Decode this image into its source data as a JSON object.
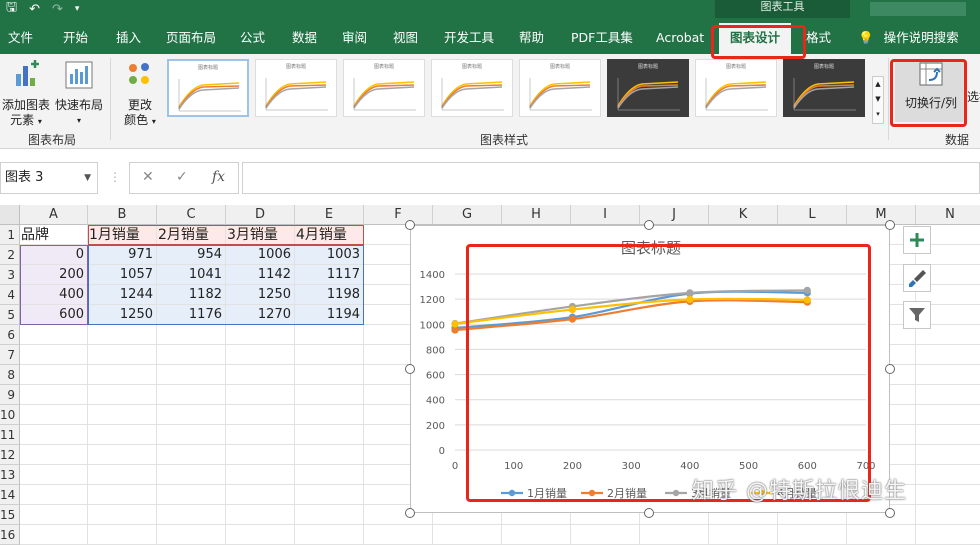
{
  "titlebar": {
    "context_label": "图表工具"
  },
  "tabs": [
    {
      "label": "文件"
    },
    {
      "label": "开始"
    },
    {
      "label": "插入"
    },
    {
      "label": "页面布局"
    },
    {
      "label": "公式"
    },
    {
      "label": "数据"
    },
    {
      "label": "审阅"
    },
    {
      "label": "视图"
    },
    {
      "label": "开发工具"
    },
    {
      "label": "帮助"
    },
    {
      "label": "PDF工具集"
    },
    {
      "label": "Acrobat"
    },
    {
      "label": "图表设计"
    },
    {
      "label": "格式"
    },
    {
      "label": "操作说明搜索"
    }
  ],
  "ribbon": {
    "add_element": "添加图表元素",
    "add_element_l1": "添加图表",
    "add_element_l2": "元素",
    "quick_layout": "快速布局",
    "group_layout": "图表布局",
    "change_colors_l1": "更改",
    "change_colors_l2": "颜色",
    "group_styles": "图表样式",
    "style_thumb_title": "图表标题",
    "switch_row_col": "切换行/列",
    "select_data": "选择",
    "group_data": "数据"
  },
  "formula_bar": {
    "name_box": "图表 3",
    "fx": "fx",
    "cancel": "✕",
    "enter": "✓",
    "formula": ""
  },
  "sheet": {
    "columns": [
      "A",
      "B",
      "C",
      "D",
      "E",
      "F",
      "G",
      "H",
      "I",
      "J",
      "K",
      "L",
      "M",
      "N"
    ],
    "rows": [
      "1",
      "2",
      "3",
      "4",
      "5",
      "6",
      "7",
      "8",
      "9",
      "10",
      "11",
      "12",
      "13",
      "14",
      "15",
      "16"
    ],
    "header_cells": [
      "品牌",
      "1月销量",
      "2月销量",
      "3月销量",
      "4月销量"
    ],
    "data_rows": [
      [
        "0",
        "971",
        "954",
        "1006",
        "1003"
      ],
      [
        "200",
        "1057",
        "1041",
        "1142",
        "1117"
      ],
      [
        "400",
        "1244",
        "1182",
        "1250",
        "1198"
      ],
      [
        "600",
        "1250",
        "1176",
        "1270",
        "1194"
      ]
    ]
  },
  "colors": {
    "excel_green": "#217346",
    "highlight": "#e8261c",
    "s1": "#5b9bd5",
    "s2": "#ed7d31",
    "s3": "#a5a5a5",
    "s4": "#ffc000"
  },
  "chart_data": {
    "type": "scatter",
    "title": "图表标题",
    "smooth": true,
    "x": [
      0,
      200,
      400,
      600
    ],
    "xlim": [
      0,
      700
    ],
    "ylim": [
      0,
      1400
    ],
    "xticks": [
      0,
      100,
      200,
      300,
      400,
      500,
      600,
      700
    ],
    "yticks": [
      0,
      200,
      400,
      600,
      800,
      1000,
      1200,
      1400
    ],
    "grid": "horizontal",
    "legend": "bottom",
    "series": [
      {
        "name": "1月销量",
        "color": "#5b9bd5",
        "values": [
          971,
          1057,
          1244,
          1250
        ]
      },
      {
        "name": "2月销量",
        "color": "#ed7d31",
        "values": [
          954,
          1041,
          1182,
          1176
        ]
      },
      {
        "name": "3月销量",
        "color": "#a5a5a5",
        "values": [
          1006,
          1142,
          1250,
          1270
        ]
      },
      {
        "name": "4月销量",
        "color": "#ffc000",
        "values": [
          1003,
          1117,
          1198,
          1194
        ]
      }
    ]
  },
  "chart_tools": [
    "chart-elements",
    "chart-styles",
    "chart-filters"
  ],
  "watermark": "知乎 @特斯拉恨迪生"
}
